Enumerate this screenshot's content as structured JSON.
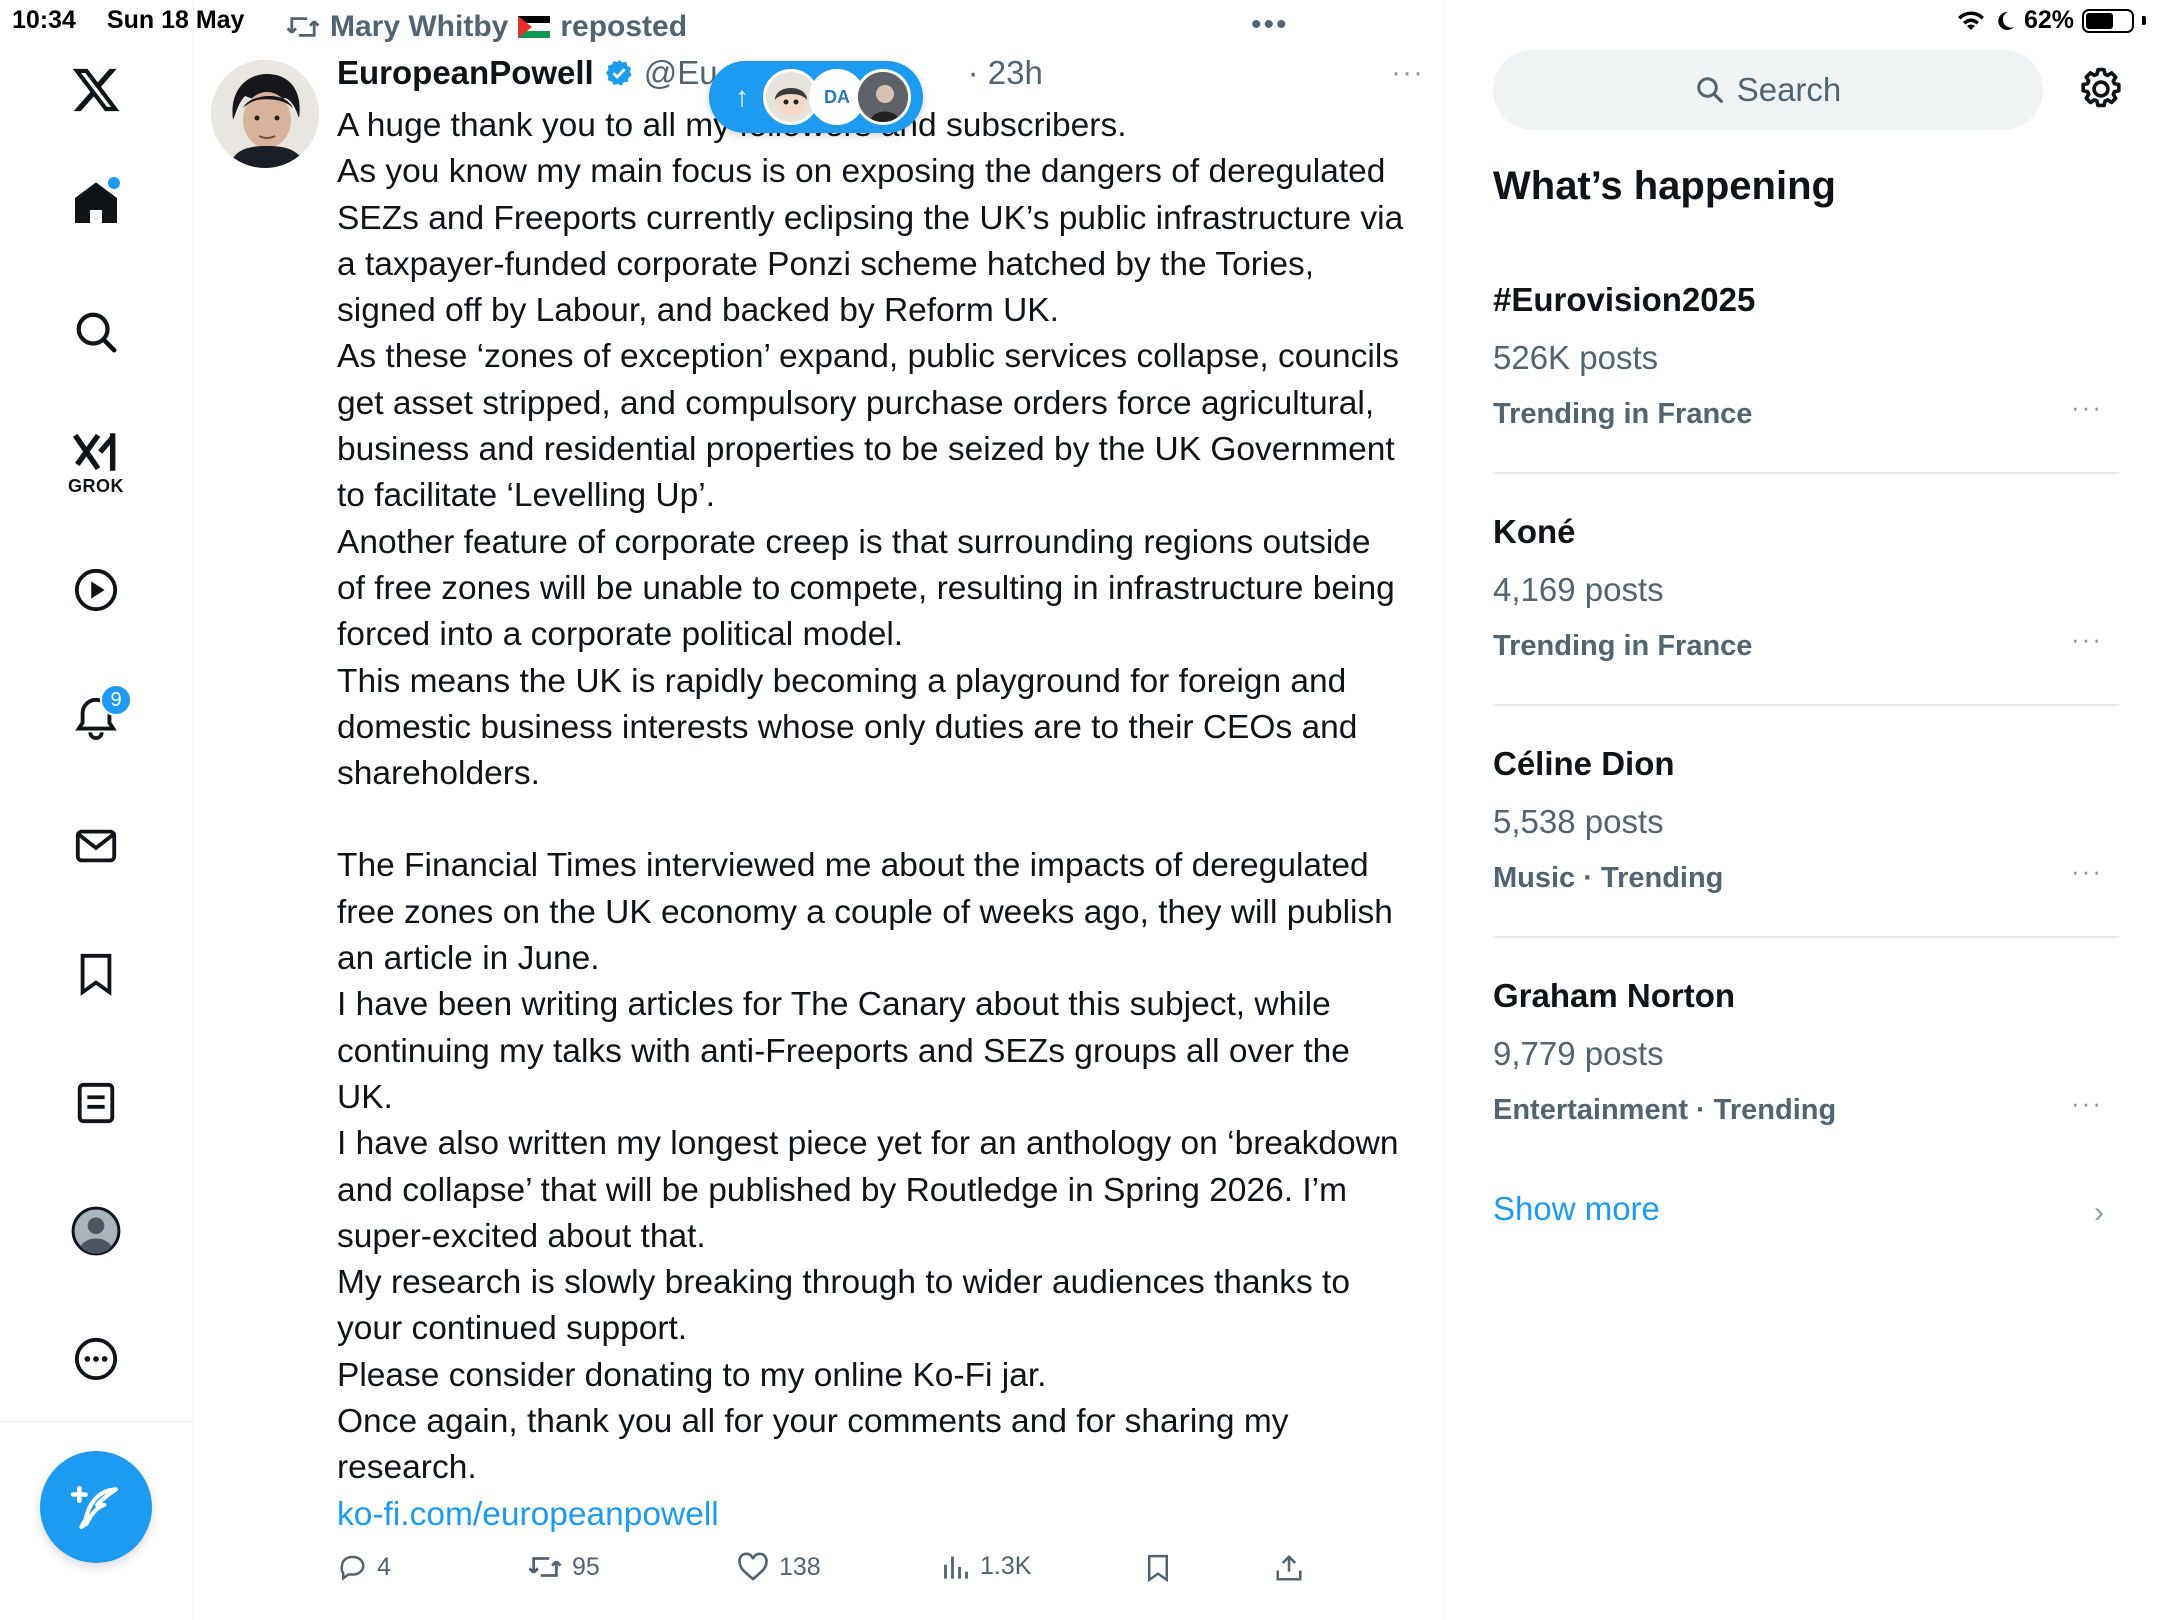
{
  "status_bar": {
    "time": "10:34",
    "date": "Sun 18 May",
    "battery": "62%",
    "battery_level": 0.62
  },
  "nav": {
    "notifications_badge": "9",
    "grok_label": "GROK",
    "items": [
      "x-logo-icon",
      "home-icon",
      "search-icon",
      "grok-icon",
      "video-icon",
      "notifications-icon",
      "messages-icon",
      "bookmarks-icon",
      "lists-icon",
      "profile-icon",
      "more-icon"
    ]
  },
  "tweet": {
    "reposted_by": "Mary Whitby",
    "reposted_suffix": "reposted",
    "author_name": "EuropeanPowell",
    "handle_visible": "@Eu",
    "time_ago": "23h",
    "more_dots": "···",
    "pill_badge_text": "DA",
    "body": [
      "A huge thank you to all my followers and subscribers.",
      "As you know my main focus is on exposing the dangers of deregulated",
      "SEZs and Freeports currently eclipsing the UK’s public infrastructure via",
      "a taxpayer-funded corporate Ponzi scheme hatched by the Tories,",
      "signed off by Labour, and backed by Reform UK.",
      "As these ‘zones of exception’ expand, public services collapse, councils",
      "get asset stripped, and compulsory purchase orders force agricultural,",
      "business and residential properties to be seized by the UK Government",
      "to facilitate ‘Levelling Up’.",
      "Another feature of corporate creep is that surrounding regions outside",
      "of free zones will be unable to compete, resulting in infrastructure being",
      "forced into a corporate political model.",
      "This means the UK is rapidly becoming a playground for foreign and",
      "domestic business interests whose only duties are to their CEOs and",
      "shareholders.",
      "",
      "The Financial Times interviewed me about the impacts of deregulated",
      "free zones on the UK economy a couple of weeks ago, they will publish",
      "an article in June.",
      "I have been writing articles for The Canary about this subject, while",
      "continuing my talks with anti-Freeports and SEZs groups all over the",
      "UK.",
      "I have also written my longest piece yet for an anthology on ‘breakdown",
      "and collapse’ that will be published by Routledge in Spring 2026. I’m",
      "super-excited about that.",
      "My research is slowly breaking through to wider audiences thanks to",
      "your continued support.",
      "Please consider donating to my online Ko-Fi jar.",
      "Once again, thank you all for your comments and for sharing my",
      "research."
    ],
    "link": "ko-fi.com/europeanpowell",
    "actions": {
      "replies": "4",
      "reposts": "95",
      "likes": "138",
      "views": "1.3K"
    }
  },
  "sidebar": {
    "search_placeholder": "Search",
    "whats_happening": "What’s happening",
    "trends": [
      {
        "name": "#Eurovision2025",
        "posts": "526K posts",
        "context": "Trending in France"
      },
      {
        "name": "Koné",
        "posts": "4,169 posts",
        "context": "Trending in France"
      },
      {
        "name": "Céline Dion",
        "posts": "5,538 posts",
        "context": "Music · Trending"
      },
      {
        "name": "Graham Norton",
        "posts": "9,779 posts",
        "context": "Entertainment · Trending"
      }
    ],
    "trend_more": "···",
    "show_more": "Show more",
    "chevron": "›"
  },
  "colors": {
    "accent": "#1d9bf0",
    "text": "#0f1419",
    "secondary": "#536471"
  }
}
